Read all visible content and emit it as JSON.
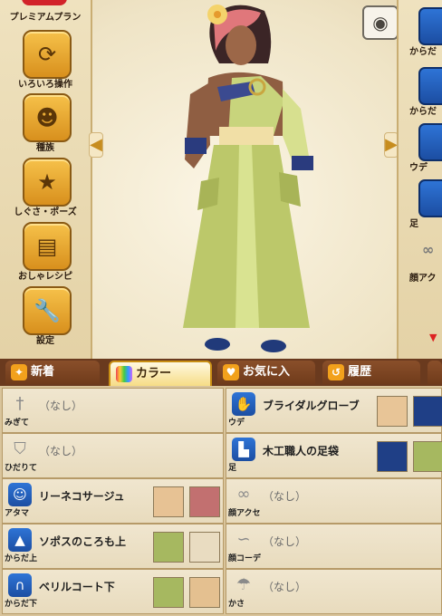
{
  "left_menu": {
    "items": [
      {
        "label": "プレミアムプラン",
        "icon": "crown-icon"
      },
      {
        "label": "いろいろ操作",
        "icon": "refresh-icon",
        "glyph": "⟳"
      },
      {
        "label": "種族",
        "icon": "race-icon",
        "glyph": "☻"
      },
      {
        "label": "しぐさ・ポーズ",
        "icon": "star-icon",
        "glyph": "★"
      },
      {
        "label": "おしゃレシピ",
        "icon": "book-icon",
        "glyph": "▤"
      },
      {
        "label": "設定",
        "icon": "wrench-icon",
        "glyph": "🔧"
      }
    ]
  },
  "right_menu": {
    "items": [
      {
        "label": "からだ"
      },
      {
        "label": "からだ"
      },
      {
        "label": "ウデ"
      },
      {
        "label": "足"
      },
      {
        "label": "顔アク"
      }
    ]
  },
  "camera_icon": "camera-icon",
  "tabs": [
    {
      "label": "新着",
      "icon": "sparkle-icon",
      "glyph": "✦",
      "color": "#f2a11c"
    },
    {
      "label": "カラー",
      "icon": "rainbow-icon",
      "glyph": "■",
      "color": "#d67de0"
    },
    {
      "label": "お気に入",
      "icon": "heart-icon",
      "glyph": "♥",
      "color": "#f2a11c"
    },
    {
      "label": "履歴",
      "icon": "history-icon",
      "glyph": "↺",
      "color": "#f2a11c"
    }
  ],
  "equipment": {
    "left": [
      {
        "slot": "みぎて",
        "name": "（なし）",
        "icon": "sword-icon",
        "glyph": "†",
        "swatches": []
      },
      {
        "slot": "ひだりて",
        "name": "（なし）",
        "icon": "shield-icon",
        "glyph": "⛉",
        "swatches": []
      },
      {
        "slot": "アタマ",
        "name": "リーネコサージュ",
        "icon": "head-icon",
        "glyph": "☺",
        "swatches": [
          "#e7c294",
          "#c27070"
        ]
      },
      {
        "slot": "からだ上",
        "name": "ソポスのころも上",
        "icon": "shirt-icon",
        "glyph": "▲",
        "swatches": [
          "#a6b860",
          "#e9dcc1"
        ]
      },
      {
        "slot": "からだ下",
        "name": "ベリルコート下",
        "icon": "pants-icon",
        "glyph": "∩",
        "swatches": [
          "#a6b860",
          "#e4c090"
        ]
      }
    ],
    "right": [
      {
        "slot": "ウデ",
        "name": "ブライダルグローブ",
        "icon": "glove-icon",
        "glyph": "✋",
        "swatches": [
          "#e8c597",
          "#1f3f86"
        ]
      },
      {
        "slot": "足",
        "name": "木工職人の足袋",
        "icon": "boot-icon",
        "glyph": "▙",
        "swatches": [
          "#1f3f86",
          "#a6b860"
        ]
      },
      {
        "slot": "顔アクセ",
        "name": "（なし）",
        "icon": "glasses-icon",
        "glyph": "∞",
        "swatches": []
      },
      {
        "slot": "顔コーデ",
        "name": "（なし）",
        "icon": "face-icon",
        "glyph": "∽",
        "swatches": []
      },
      {
        "slot": "かさ",
        "name": "（なし）",
        "icon": "umbrella-icon",
        "glyph": "☂",
        "swatches": []
      }
    ]
  }
}
